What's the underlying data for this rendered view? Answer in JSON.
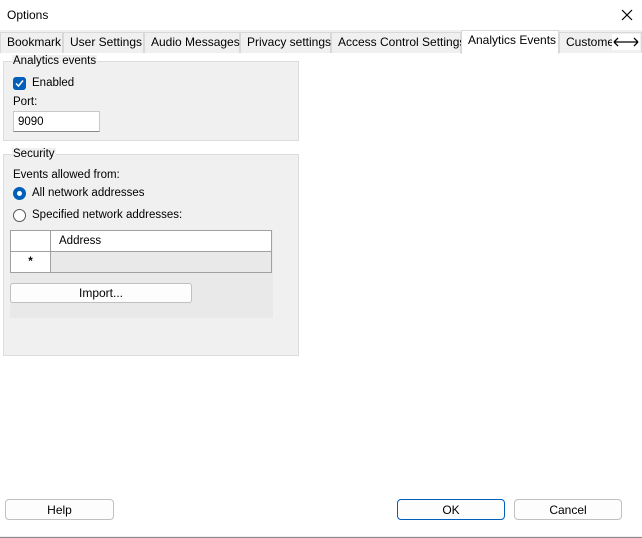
{
  "window": {
    "title": "Options"
  },
  "tabs": [
    {
      "label": "Bookmark"
    },
    {
      "label": "User Settings"
    },
    {
      "label": "Audio Messages"
    },
    {
      "label": "Privacy settings"
    },
    {
      "label": "Access Control Settings"
    },
    {
      "label": "Analytics Events",
      "active": true
    },
    {
      "label": "Custome"
    }
  ],
  "analytics": {
    "group_title": "Analytics events",
    "enabled_label": "Enabled",
    "enabled_checked": true,
    "port_label": "Port:",
    "port_value": "9090"
  },
  "security": {
    "group_title": "Security",
    "events_allowed_label": "Events allowed from:",
    "option_all": "All network addresses",
    "option_specified": "Specified network addresses:",
    "selected": "all",
    "table": {
      "header": "Address",
      "new_row_marker": "*"
    },
    "import_label": "Import..."
  },
  "footer": {
    "help_label": "Help",
    "ok_label": "OK",
    "cancel_label": "Cancel"
  },
  "colors": {
    "accent": "#005fb8"
  }
}
